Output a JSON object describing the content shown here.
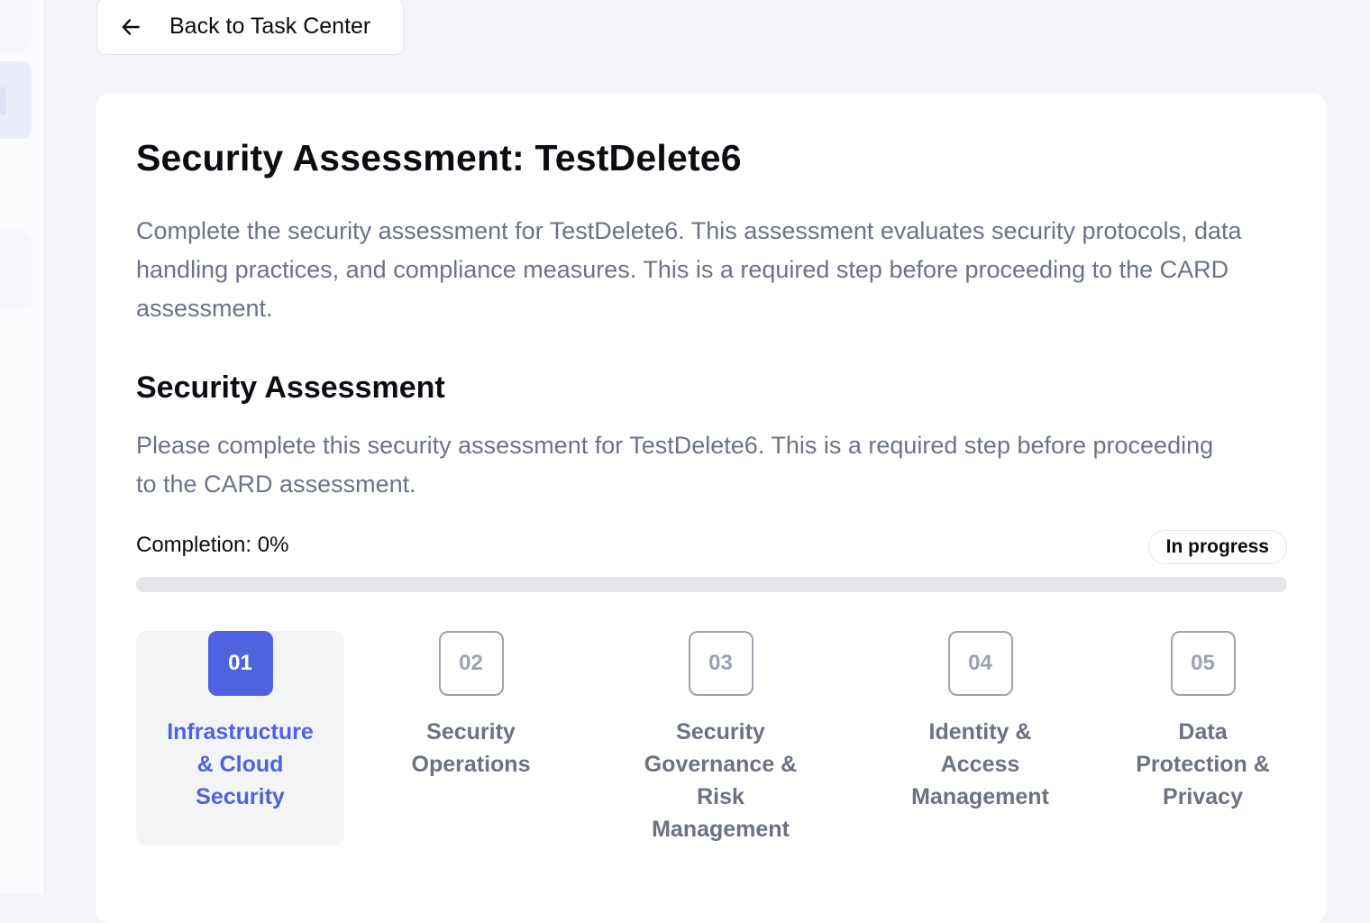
{
  "back_button": {
    "label": "Back to Task Center"
  },
  "header": {
    "title": "Security Assessment: TestDelete6",
    "description": "Complete the security assessment for TestDelete6. This assessment evaluates security protocols, data handling practices, and compliance measures. This is a required step before proceeding to the CARD assessment."
  },
  "assessment": {
    "title": "Security Assessment",
    "description": "Please complete this security assessment for TestDelete6. This is a required step before proceeding to the CARD assessment.",
    "completion_label": "Completion: 0%",
    "completion_fraction": 0,
    "status": "In progress"
  },
  "steps": [
    {
      "number": "01",
      "label": "Infrastructure & Cloud Security",
      "active": true
    },
    {
      "number": "02",
      "label": "Security Operations",
      "active": false
    },
    {
      "number": "03",
      "label": "Security Governance & Risk Management",
      "active": false
    },
    {
      "number": "04",
      "label": "Identity & Access Management",
      "active": false
    },
    {
      "number": "05",
      "label": "Data Protection & Privacy",
      "active": false
    }
  ],
  "colors": {
    "accent": "#4f63e0",
    "muted_text": "#6b7385",
    "page_background": "#f4f5f9"
  },
  "icons": {
    "back": "arrow-left-icon"
  }
}
